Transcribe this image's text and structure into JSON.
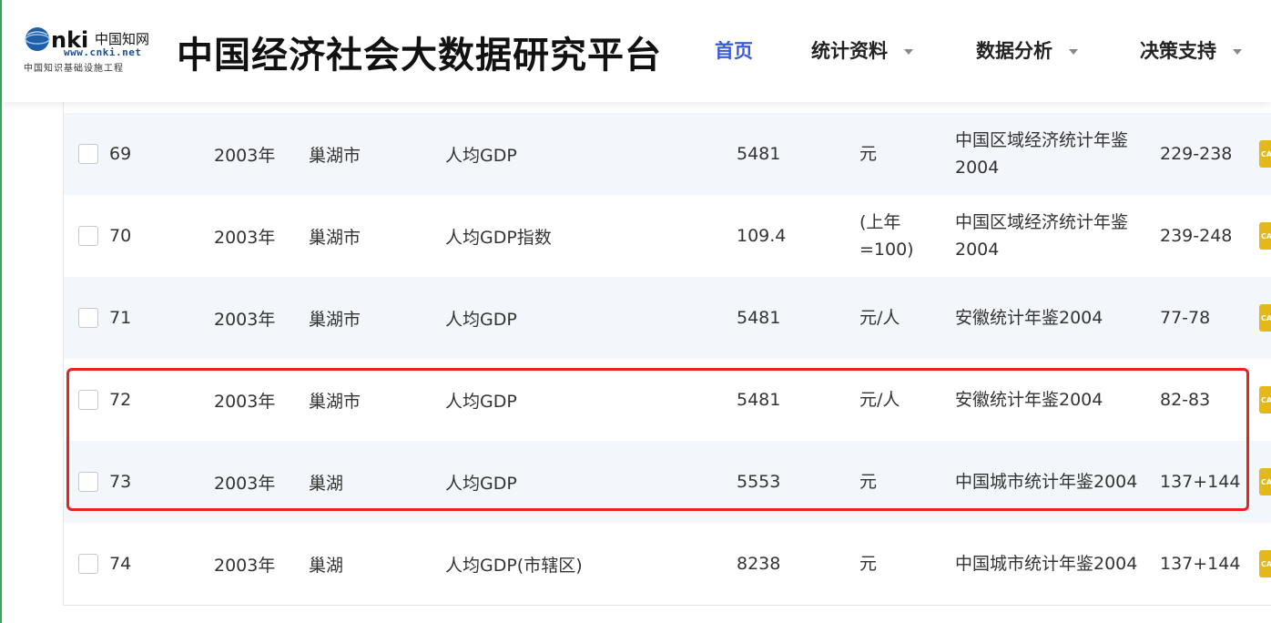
{
  "header": {
    "logo": {
      "mark": "cnki中国知网",
      "url": "www.cnki.net",
      "sub": "中国知识基础设施工程"
    },
    "title": "中国经济社会大数据研究平台",
    "nav": [
      {
        "label": "首页",
        "active": true
      },
      {
        "label": "统计资料"
      },
      {
        "label": "数据分析"
      },
      {
        "label": "决策支持"
      }
    ],
    "accent_color": "#3b5bdb"
  },
  "table": {
    "rows": [
      {
        "id": "69",
        "year": "2003年",
        "city": "巢湖市",
        "indicator": "人均GDP",
        "value": "5481",
        "unit": "元",
        "source": "中国区域经济统计年鉴2004",
        "pages": "229-238",
        "tag": "CA",
        "striped": true
      },
      {
        "id": "70",
        "year": "2003年",
        "city": "巢湖市",
        "indicator": "人均GDP指数",
        "value": "109.4",
        "unit": "(上年=100)",
        "source": "中国区域经济统计年鉴2004",
        "pages": "239-248",
        "tag": "CA",
        "striped": false
      },
      {
        "id": "71",
        "year": "2003年",
        "city": "巢湖市",
        "indicator": "人均GDP",
        "value": "5481",
        "unit": "元/人",
        "source": "安徽统计年鉴2004",
        "pages": "77-78",
        "tag": "CA",
        "striped": true
      },
      {
        "id": "72",
        "year": "2003年",
        "city": "巢湖市",
        "indicator": "人均GDP",
        "value": "5481",
        "unit": "元/人",
        "source": "安徽统计年鉴2004",
        "pages": "82-83",
        "tag": "CA",
        "striped": false
      },
      {
        "id": "73",
        "year": "2003年",
        "city": "巢湖",
        "indicator": "人均GDP",
        "value": "5553",
        "unit": "元",
        "source": "中国城市统计年鉴2004",
        "pages": "137+144",
        "tag": "CA",
        "striped": true
      },
      {
        "id": "74",
        "year": "2003年",
        "city": "巢湖",
        "indicator": "人均GDP(市辖区)",
        "value": "8238",
        "unit": "元",
        "source": "中国城市统计年鉴2004",
        "pages": "137+144",
        "tag": "CA",
        "striped": false
      }
    ]
  },
  "highlight_color": "#e8231e"
}
